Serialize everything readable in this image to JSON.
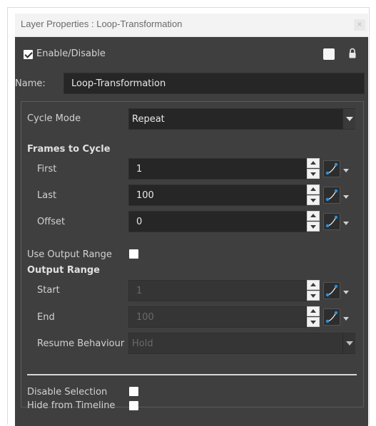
{
  "window": {
    "title": "Layer Properties : Loop-Transformation",
    "close_symbol": "×"
  },
  "enable": {
    "label": "Enable/Disable",
    "checked": true
  },
  "name_row": {
    "label": "Name:",
    "value": "Loop-Transformation"
  },
  "cycle_mode": {
    "label": "Cycle Mode",
    "value": "Repeat"
  },
  "frames_to_cycle": {
    "heading": "Frames to Cycle",
    "first": {
      "label": "First",
      "value": "1"
    },
    "last": {
      "label": "Last",
      "value": "100"
    },
    "offset": {
      "label": "Offset",
      "value": "0"
    }
  },
  "use_output_range": {
    "label": "Use Output Range",
    "checked": false
  },
  "output_range": {
    "heading": "Output Range",
    "start": {
      "label": "Start",
      "value": "1"
    },
    "end": {
      "label": "End",
      "value": "100"
    },
    "resume_behaviour": {
      "label": "Resume Behaviour",
      "value": "Hold"
    }
  },
  "disable_selection": {
    "label": "Disable Selection",
    "checked": false
  },
  "hide_from_timeline": {
    "label": "Hide from Timeline",
    "checked": false
  },
  "colors": {
    "panel_bg": "#3f3f3f",
    "field_bg": "#262626",
    "accent_blue": "#2f8fd8"
  },
  "icons": [
    "checkbox-icon",
    "color-swatch-icon",
    "lock-icon",
    "spin-up-icon",
    "spin-down-icon",
    "function-curve-icon",
    "chevron-down-icon",
    "close-icon"
  ]
}
